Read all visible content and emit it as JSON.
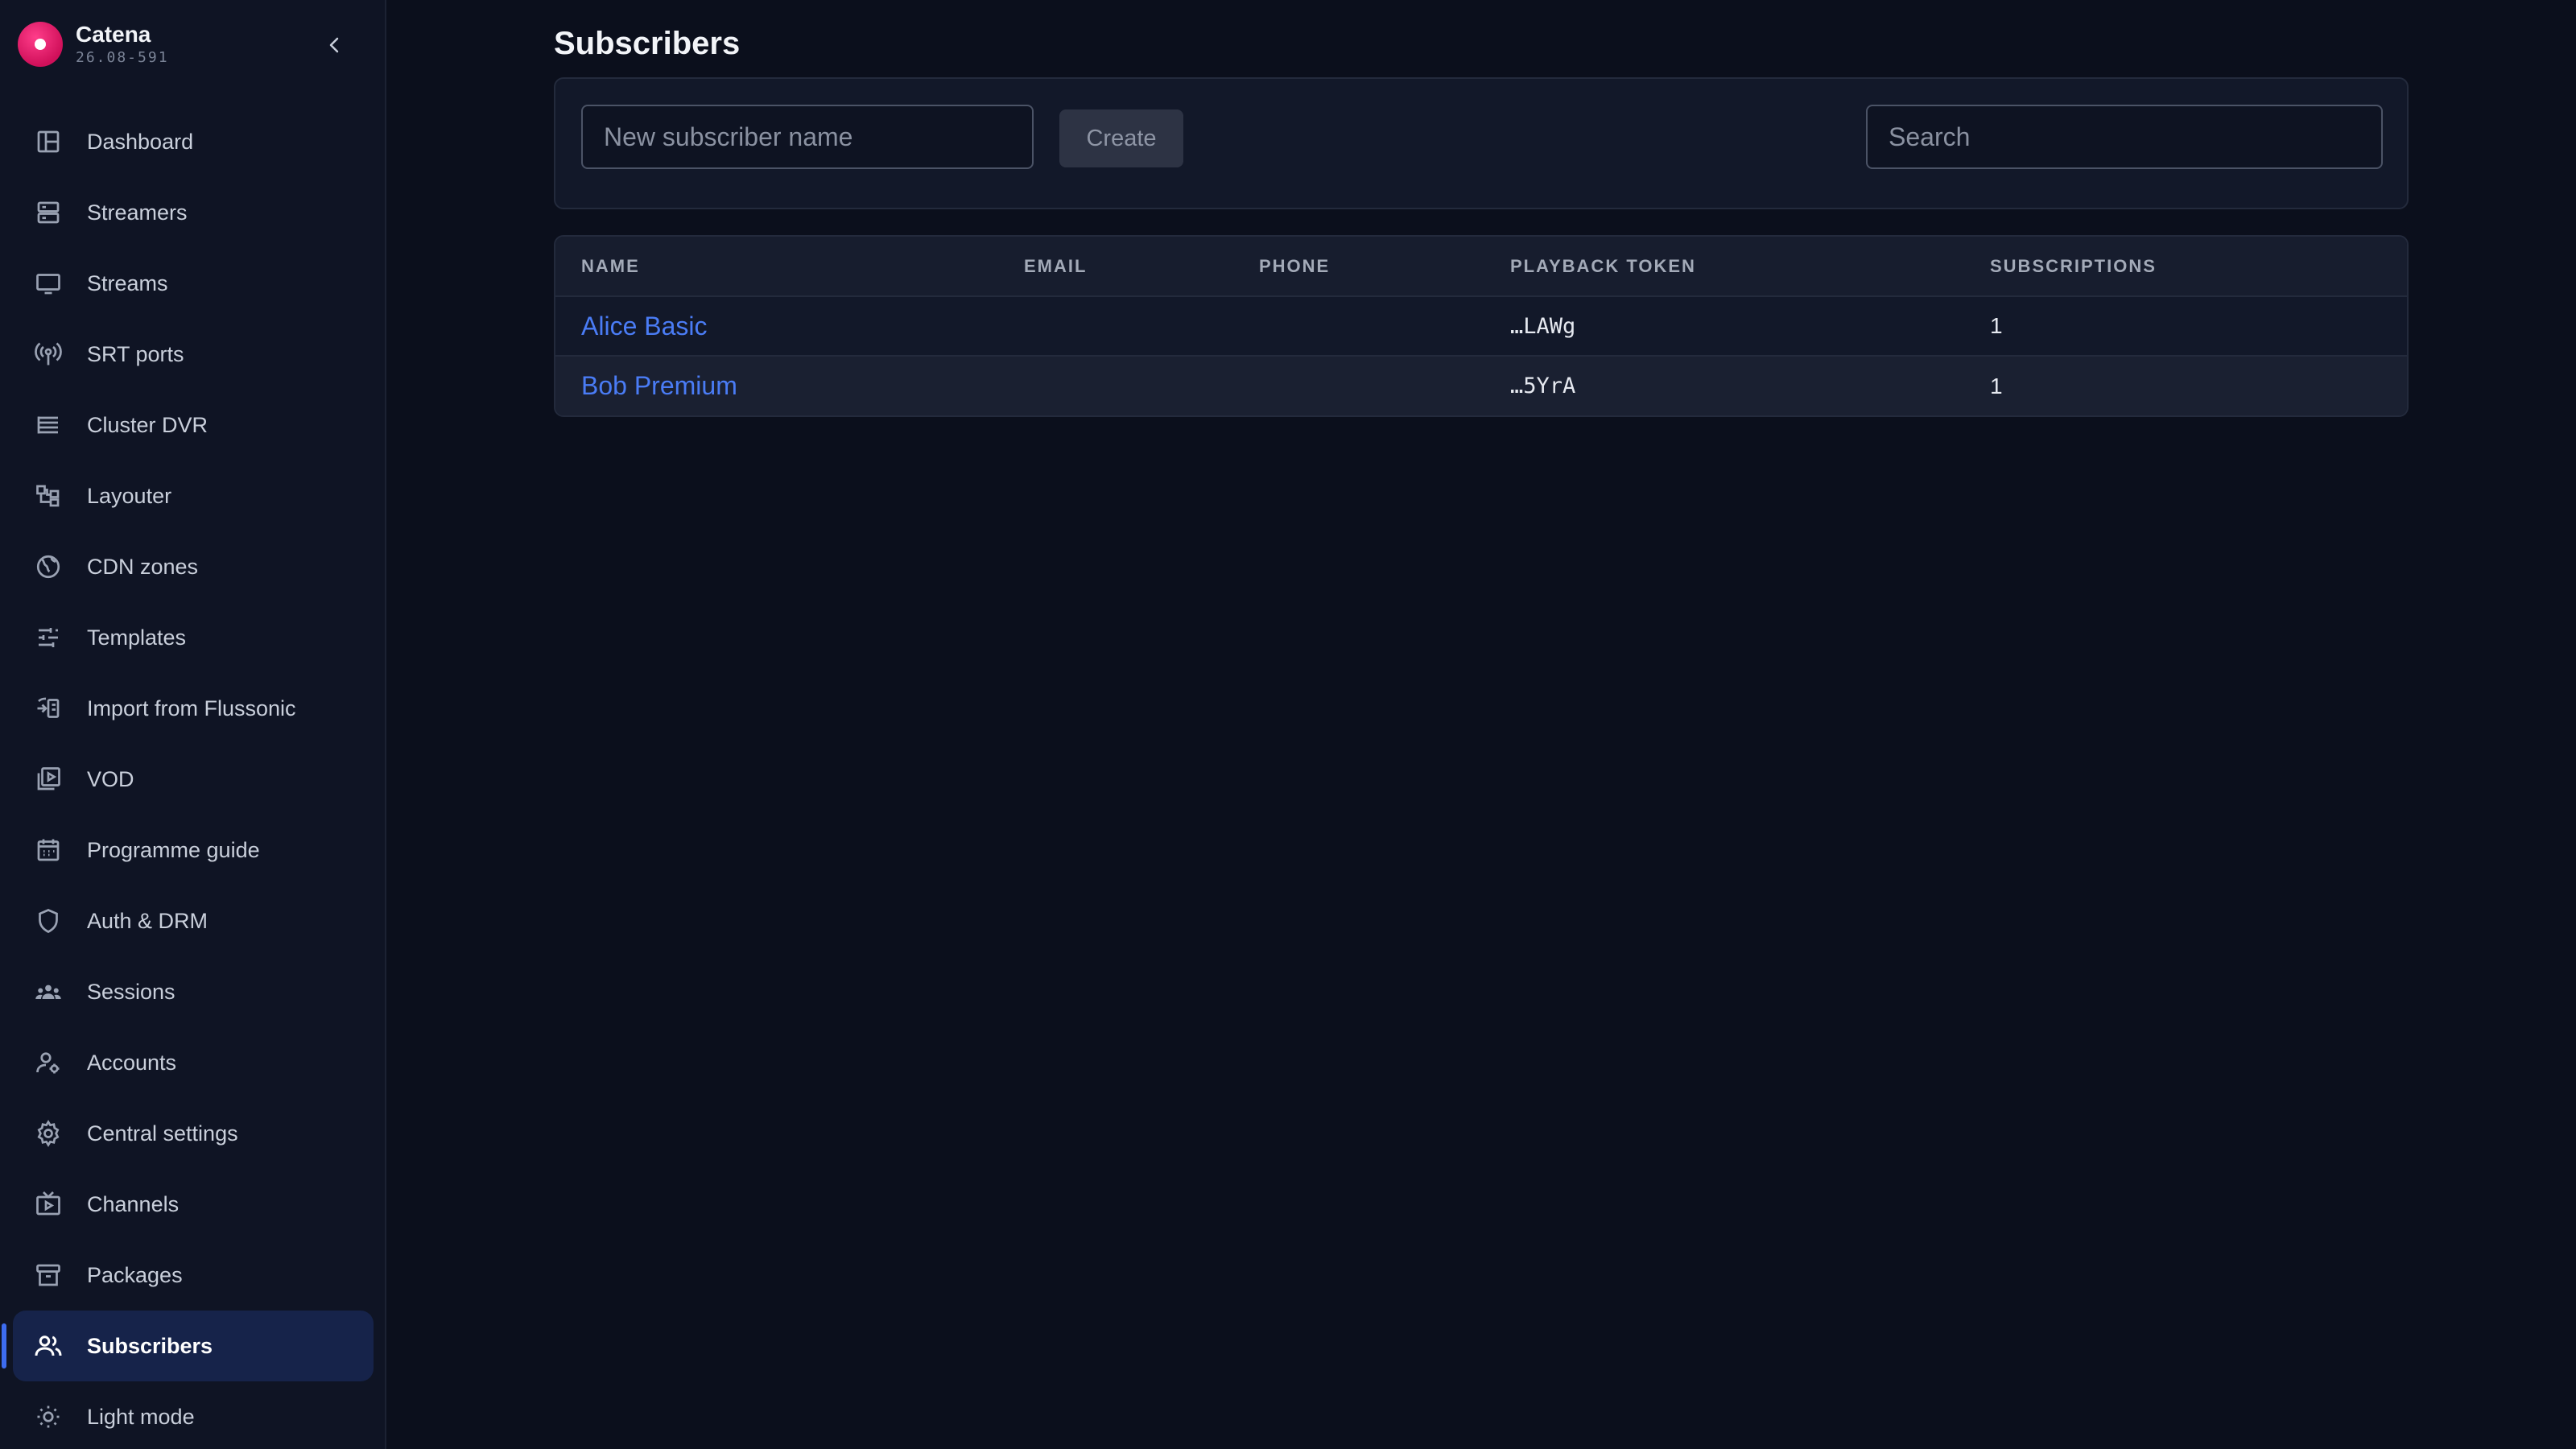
{
  "brand": {
    "name": "Catena",
    "version": "26.08-591"
  },
  "sidebar": {
    "items": [
      {
        "label": "Dashboard",
        "icon": "dashboard-icon"
      },
      {
        "label": "Streamers",
        "icon": "server-icon"
      },
      {
        "label": "Streams",
        "icon": "monitor-icon"
      },
      {
        "label": "SRT ports",
        "icon": "antenna-icon"
      },
      {
        "label": "Cluster DVR",
        "icon": "database-icon"
      },
      {
        "label": "Layouter",
        "icon": "layout-icon"
      },
      {
        "label": "CDN zones",
        "icon": "globe-icon"
      },
      {
        "label": "Templates",
        "icon": "sliders-icon"
      },
      {
        "label": "Import from Flussonic",
        "icon": "import-icon"
      },
      {
        "label": "VOD",
        "icon": "video-library-icon"
      },
      {
        "label": "Programme guide",
        "icon": "calendar-icon"
      },
      {
        "label": "Auth & DRM",
        "icon": "shield-icon"
      },
      {
        "label": "Sessions",
        "icon": "group-icon"
      },
      {
        "label": "Accounts",
        "icon": "user-gear-icon"
      },
      {
        "label": "Central settings",
        "icon": "gear-icon"
      },
      {
        "label": "Channels",
        "icon": "tv-icon"
      },
      {
        "label": "Packages",
        "icon": "archive-icon"
      },
      {
        "label": "Subscribers",
        "icon": "users-icon",
        "active": true
      },
      {
        "label": "Light mode",
        "icon": "sun-icon"
      }
    ]
  },
  "main": {
    "title": "Subscribers",
    "new_name_placeholder": "New subscriber name",
    "create_label": "Create",
    "search_placeholder": "Search",
    "table": {
      "headers": {
        "name": "NAME",
        "email": "EMAIL",
        "phone": "PHONE",
        "token": "PLAYBACK TOKEN",
        "subscriptions": "SUBSCRIPTIONS"
      },
      "rows": [
        {
          "name": "Alice Basic",
          "email": "",
          "phone": "",
          "token": "…LAWg",
          "subscriptions": "1"
        },
        {
          "name": "Bob Premium",
          "email": "",
          "phone": "",
          "token": "…5YrA",
          "subscriptions": "1"
        }
      ]
    }
  },
  "colors": {
    "accent": "#3d6cf0",
    "link": "#4a7cf5",
    "brand": "#e0195f",
    "background": "#0b0f1c"
  }
}
